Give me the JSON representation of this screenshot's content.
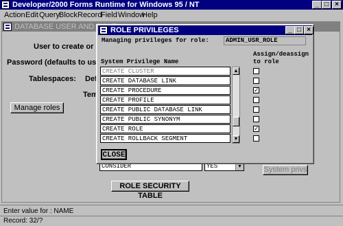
{
  "app": {
    "title": "Developer/2000 Forms Runtime for Windows 95 / NT"
  },
  "menu": [
    "Action",
    "Edit",
    "Query",
    "Block",
    "Record",
    "Field",
    "Window",
    "Help"
  ],
  "main_window": {
    "title": "DATABASE USER AND ROLE",
    "labels": {
      "user": "User to create or mo",
      "password": "Password (defaults to userna",
      "tablespaces": "Tablespaces:",
      "def": "Def",
      "tempo": "Tempo"
    },
    "manage_roles": "Manage roles",
    "consider_value": "CONSIDER",
    "yes_value": "YES",
    "system_privs": "System privs",
    "role_security_table": "ROLE SECURITY TABLE"
  },
  "dialog": {
    "title": "ROLE PRIVILEGES",
    "managing_label": "Managing privileges for role:",
    "role_value": "ADMIN_USR_ROLE",
    "col_privilege": "System Privilege Name",
    "col_assign_line1": "Assign/deassign",
    "col_assign_line2": "to role",
    "rows": [
      {
        "name": "CREATE CLUSTER",
        "checked": ""
      },
      {
        "name": "CREATE DATABASE LINK",
        "checked": ""
      },
      {
        "name": "CREATE PROCEDURE",
        "checked": "✓"
      },
      {
        "name": "CREATE PROFILE",
        "checked": ""
      },
      {
        "name": "CREATE PUBLIC DATABASE LINK",
        "checked": ""
      },
      {
        "name": "CREATE PUBLIC SYNONYM",
        "checked": ""
      },
      {
        "name": "CREATE ROLE",
        "checked": "✓"
      },
      {
        "name": "CREATE ROLLBACK SEGMENT",
        "checked": ""
      }
    ],
    "close": "CLOSE"
  },
  "status": {
    "line1": "Enter value for : NAME",
    "line2": "Record: 32/?"
  },
  "colors": {
    "titlebar": "#000080",
    "inactive_title": "#808080"
  }
}
